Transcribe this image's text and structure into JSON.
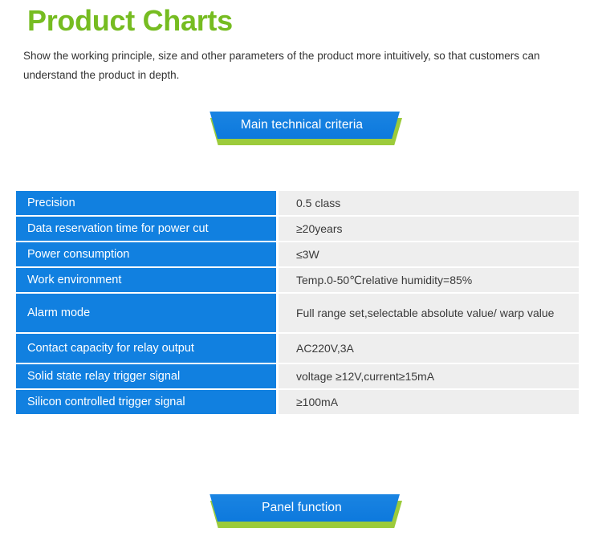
{
  "header": {
    "title": "Product Charts",
    "subtitle": "Show the working principle, size and other parameters of the product more intuitively, so that customers can understand the product in depth."
  },
  "colors": {
    "title_green": "#76bc21",
    "banner_blue": "#1180e0",
    "banner_green": "#9ccb3b",
    "row_key_blue": "#1180e0",
    "row_value_gray": "#eeeeee"
  },
  "sections": [
    {
      "id": "main-technical-criteria",
      "label": "Main technical criteria"
    },
    {
      "id": "panel-function",
      "label": "Panel function"
    }
  ],
  "spec_table": {
    "rows": [
      {
        "key": "Precision",
        "value": "0.5 class",
        "size": "h-sm"
      },
      {
        "key": "Data reservation time for power cut",
        "value": "≥20years",
        "size": "h-sm"
      },
      {
        "key": "Power consumption",
        "value": "≤3W",
        "size": "h-sm"
      },
      {
        "key": "Work environment",
        "value": "Temp.0-50℃relative humidity=85%",
        "size": "h-sm"
      },
      {
        "key": "Alarm mode",
        "value": "Full range set,selectable absolute value/ warp value",
        "size": "h-lg"
      },
      {
        "key": "Contact capacity for relay output",
        "value": "AC220V,3A",
        "size": "h-md"
      },
      {
        "key": "Solid state relay trigger signal",
        "value": "voltage ≥12V,current≥15mA",
        "size": "h-sm"
      },
      {
        "key": "Silicon controlled trigger signal",
        "value": "≥100mA",
        "size": "h-sm"
      }
    ]
  }
}
